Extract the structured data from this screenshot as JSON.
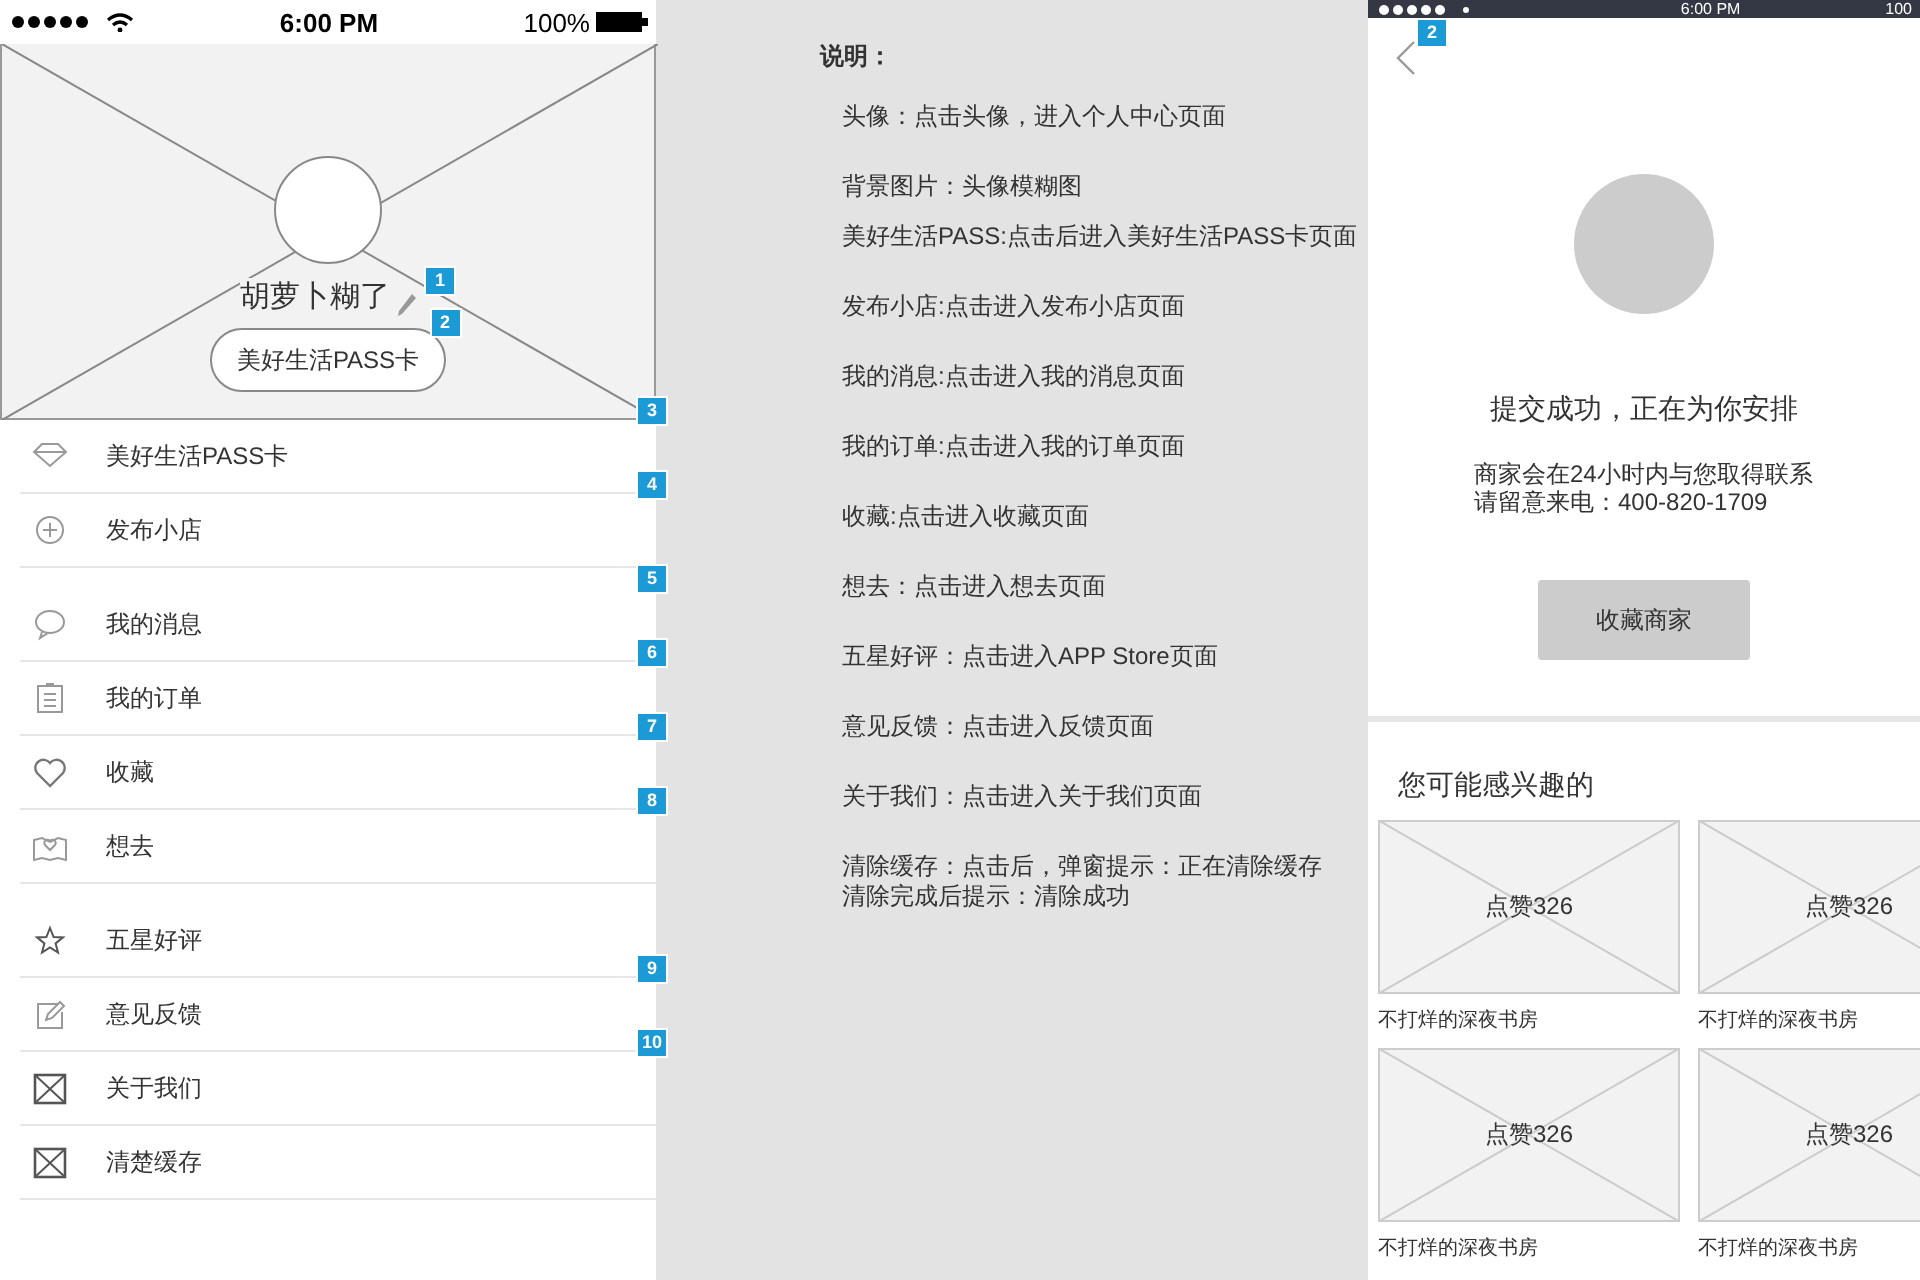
{
  "left_phone": {
    "status_bar": {
      "time": "6:00 PM",
      "battery": "100%"
    },
    "profile": {
      "name": "胡萝卜糊了",
      "name_badge": "1",
      "pass_button": "美好生活PASS卡",
      "pass_badge": "2"
    },
    "menu_groups": [
      [
        {
          "label": "美好生活PASS卡",
          "kind": "diamond",
          "badge": "3"
        },
        {
          "label": "发布小店",
          "kind": "plus",
          "badge": "4"
        }
      ],
      [
        {
          "label": "我的消息",
          "kind": "chat",
          "badge": "5"
        },
        {
          "label": "我的订单",
          "kind": "clipboard",
          "badge": "6"
        },
        {
          "label": "收藏",
          "kind": "heart",
          "badge": "7"
        },
        {
          "label": "想去",
          "kind": "map",
          "badge": "8"
        }
      ],
      [
        {
          "label": "五星好评",
          "kind": "star"
        },
        {
          "label": "意见反馈",
          "kind": "edit",
          "badge": "9"
        },
        {
          "label": "关于我们",
          "kind": "placeholder",
          "badge": "10"
        },
        {
          "label": "清楚缓存",
          "kind": "placeholder"
        }
      ]
    ]
  },
  "notes": {
    "title": "说明：",
    "items": [
      "头像：点击头像，进入个人中心页面",
      "背景图片：头像模糊图",
      "美好生活PASS:点击后进入美好生活PASS卡页面",
      "发布小店:点击进入发布小店页面",
      "我的消息:点击进入我的消息页面",
      "我的订单:点击进入我的订单页面",
      "收藏:点击进入收藏页面",
      "想去：点击进入想去页面",
      "五星好评：点击进入APP Store页面",
      "意见反馈：点击进入反馈页面",
      "关于我们：点击进入关于我们页面",
      [
        "清除缓存：点击后，弹窗提示：正在清除缓存",
        "清除完成后提示：清除成功"
      ]
    ]
  },
  "right_phone": {
    "status_bar": {
      "time": "6:00 PM",
      "battery": "100"
    },
    "back_badge": "2",
    "title": "提交成功，正在为你安排",
    "message_lines": [
      "商家会在24小时内与您取得联系",
      "请留意来电：400-820-1709"
    ],
    "button": "收藏商家",
    "section_title": "您可能感兴趣的",
    "cards": [
      {
        "likes": "点赞326",
        "caption": "不打烊的深夜书房"
      },
      {
        "likes": "点赞326",
        "caption": "不打烊的深夜书房"
      },
      {
        "likes": "点赞326",
        "caption": "不打烊的深夜书房"
      },
      {
        "likes": "点赞326",
        "caption": "不打烊的深夜书房"
      }
    ]
  }
}
